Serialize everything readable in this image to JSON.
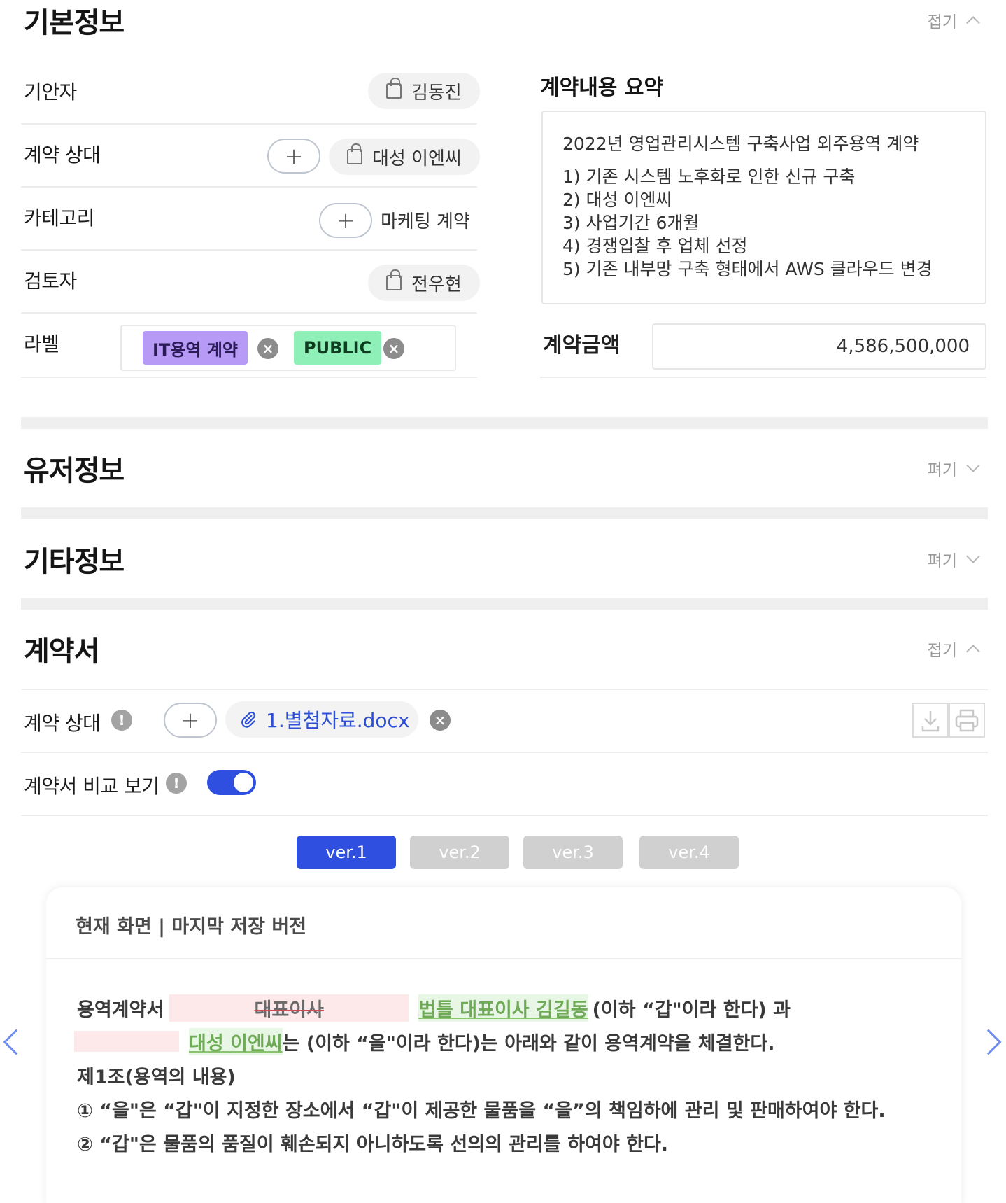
{
  "basic": {
    "title": "기본정보",
    "toggle": "접기",
    "drafter_label": "기안자",
    "drafter_name": "김동진",
    "counterparty_label": "계약 상대",
    "counterparty_plus": "+",
    "counterparty_name": "대성 이엔씨",
    "category_label": "카테고리",
    "category_plus": "+",
    "category_value": "마케팅 계약",
    "reviewer_label": "검토자",
    "reviewer_name": "전우현",
    "labels_label": "라벨",
    "tags": [
      {
        "text": "IT용역 계약",
        "bg": "#b79af5",
        "color": "#2a1a55"
      },
      {
        "text": "PUBLIC",
        "bg": "#8ef0b6",
        "color": "#0f3d22"
      }
    ],
    "tag_remove": "×",
    "summary_title": "계약내용 요약",
    "summary_head": "2022년 영업관리시스템 구축사업 외주용역 계약",
    "summary_lines": [
      "1) 기존 시스템 노후화로 인한 신규 구축",
      "2) 대성 이엔씨",
      "3) 사업기간 6개월",
      "4) 경쟁입찰 후 업체 선정",
      "5) 기존 내부망 구축 형태에서 AWS 클라우드 변경"
    ],
    "amount_label": "계약금액",
    "amount_value": "4,586,500,000"
  },
  "user_info": {
    "title": "유저정보",
    "toggle": "펴기"
  },
  "etc_info": {
    "title": "기타정보",
    "toggle": "펴기"
  },
  "contract": {
    "title": "계약서",
    "toggle": "접기",
    "party_label": "계약 상대",
    "warn_glyph": "!",
    "plus": "+",
    "file_name": "1.별첨자료.docx",
    "file_remove": "×",
    "compare_label": "계약서 비교 보기",
    "compare_on": true,
    "versions": [
      {
        "label": "ver.1",
        "active": true
      },
      {
        "label": "ver.2",
        "active": false
      },
      {
        "label": "ver.3",
        "active": false
      },
      {
        "label": "ver.4",
        "active": false
      }
    ],
    "active_color": "#2e4fe0",
    "inactive_color": "#d0d0d0"
  },
  "compare_card": {
    "header": "현재 화면 | 마지막 저장 버전",
    "line1_prefix": "용역계약서",
    "line1_deleted": "대표이사",
    "line1_inserted": "법틀 대표이사 김길동",
    "line1_suffix": "(이하 “갑\"이라 한다) 과",
    "line2_deleted": "",
    "line2_inserted": "대성 이엔씨",
    "line2_suffix": "는 (이하 “을\"이라 한다)는 아래와 같이 용역계약을 체결한다.",
    "line3": "제1조(용역의 내용)",
    "line4": "① “을\"은 “갑\"이 지정한 장소에서 “갑\"이 제공한 물품을 “을”의 책임하에 관리 및 판매하여야 한다.",
    "line5": "② “갑\"은 물품의 품질이 훼손되지 아니하도록 선의의 관리를 하여야 한다."
  }
}
